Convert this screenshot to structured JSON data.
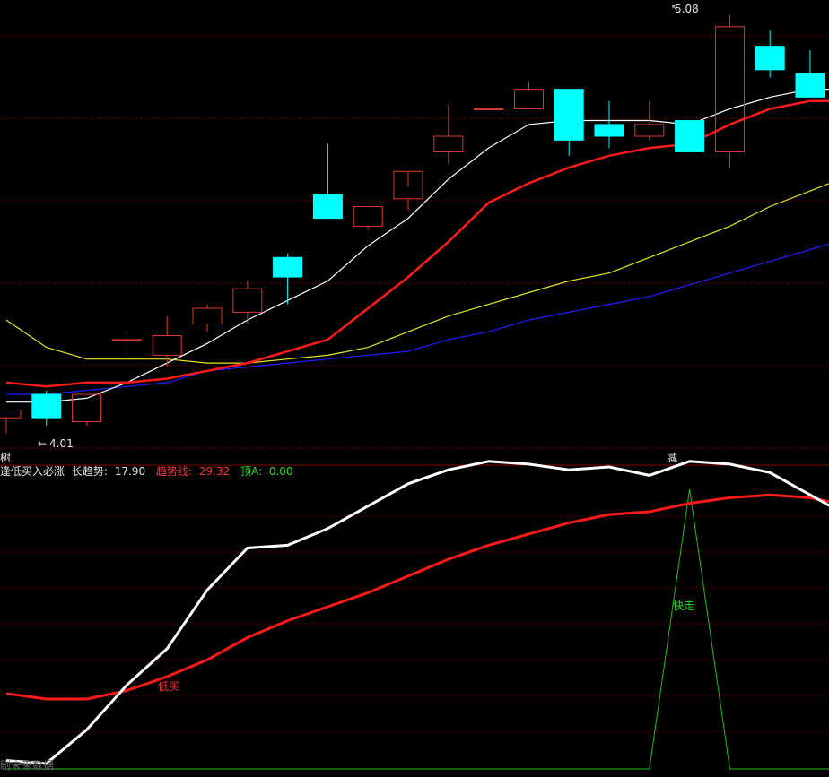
{
  "colors": {
    "background": "#000000",
    "grid": "#7a0000",
    "up_candle": "#e0392b",
    "down_candle": "#00ffff",
    "ma_short": "#ffffff",
    "ma_mid": "#ff1a1a",
    "ma_long1": "#e6e61e",
    "ma_long2": "#1e1eff",
    "osc_fast": "#ffffff",
    "osc_slow": "#ff1a1a",
    "signal": "#1ebe1e",
    "legend_white": "#e6e6e6",
    "legend_red": "#ff3030",
    "legend_green": "#22dd22"
  },
  "price_panel": {
    "high_marker": "5.08",
    "low_marker": "4.01",
    "left_label": "树",
    "right_label": "减"
  },
  "indicator_panel": {
    "title": "逢低买入必涨",
    "items": [
      {
        "label": "长趋势:",
        "value": "17.90"
      },
      {
        "label": "趋势线:",
        "value": "29.32"
      },
      {
        "label": "顶A:",
        "value": "0.00"
      }
    ],
    "buy_label": "低买",
    "sell_label": "快走",
    "footer_label": "剧未来数据"
  },
  "chart_data": [
    {
      "type": "candlestick",
      "ylim": [
        4.0,
        5.1
      ],
      "candles": [
        {
          "o": 4.05,
          "h": 4.07,
          "l": 4.01,
          "c": 4.07
        },
        {
          "o": 4.11,
          "h": 4.12,
          "l": 4.03,
          "c": 4.05
        },
        {
          "o": 4.04,
          "h": 4.11,
          "l": 4.03,
          "c": 4.11
        },
        {
          "o": 4.25,
          "h": 4.27,
          "l": 4.21,
          "c": 4.25
        },
        {
          "o": 4.21,
          "h": 4.31,
          "l": 4.18,
          "c": 4.26
        },
        {
          "o": 4.29,
          "h": 4.34,
          "l": 4.27,
          "c": 4.33
        },
        {
          "o": 4.32,
          "h": 4.4,
          "l": 4.29,
          "c": 4.38
        },
        {
          "o": 4.46,
          "h": 4.47,
          "l": 4.34,
          "c": 4.41
        },
        {
          "o": 4.62,
          "h": 4.75,
          "l": 4.56,
          "c": 4.56
        },
        {
          "o": 4.54,
          "h": 4.59,
          "l": 4.53,
          "c": 4.59
        },
        {
          "o": 4.61,
          "h": 4.64,
          "l": 4.58,
          "c": 4.68
        },
        {
          "o": 4.73,
          "h": 4.85,
          "l": 4.7,
          "c": 4.77
        },
        {
          "o": 4.84,
          "h": 4.84,
          "l": 4.84,
          "c": 4.84
        },
        {
          "o": 4.84,
          "h": 4.91,
          "l": 4.84,
          "c": 4.89
        },
        {
          "o": 4.89,
          "h": 4.89,
          "l": 4.72,
          "c": 4.76
        },
        {
          "o": 4.8,
          "h": 4.86,
          "l": 4.74,
          "c": 4.77
        },
        {
          "o": 4.77,
          "h": 4.86,
          "l": 4.76,
          "c": 4.8
        },
        {
          "o": 4.81,
          "h": 4.81,
          "l": 4.73,
          "c": 4.73
        },
        {
          "o": 4.73,
          "h": 5.08,
          "l": 4.69,
          "c": 5.05
        },
        {
          "o": 5.0,
          "h": 5.04,
          "l": 4.92,
          "c": 4.94
        },
        {
          "o": 4.93,
          "h": 4.99,
          "l": 4.87,
          "c": 4.87
        },
        {
          "o": 4.88,
          "h": 4.93,
          "l": 4.82,
          "c": 4.82
        },
        {
          "o": 4.82,
          "h": 4.84,
          "l": 4.76,
          "c": 4.76
        }
      ],
      "ma_short": [
        4.09,
        4.09,
        4.1,
        4.14,
        4.19,
        4.24,
        4.3,
        4.35,
        4.4,
        4.49,
        4.56,
        4.66,
        4.74,
        4.8,
        4.81,
        4.81,
        4.81,
        4.8,
        4.84,
        4.87,
        4.89,
        4.89,
        4.88
      ],
      "ma_mid": [
        4.14,
        4.13,
        4.14,
        4.14,
        4.15,
        4.17,
        4.19,
        4.22,
        4.25,
        4.33,
        4.41,
        4.5,
        4.6,
        4.65,
        4.69,
        4.72,
        4.74,
        4.75,
        4.8,
        4.84,
        4.86,
        4.86,
        4.85
      ],
      "ma_long1": [
        4.3,
        4.23,
        4.2,
        4.2,
        4.2,
        4.19,
        4.19,
        4.2,
        4.21,
        4.23,
        4.27,
        4.31,
        4.34,
        4.37,
        4.4,
        4.42,
        4.46,
        4.5,
        4.54,
        4.59,
        4.63,
        4.67,
        4.7
      ],
      "ma_long2": [
        4.11,
        4.11,
        4.12,
        4.13,
        4.14,
        4.17,
        4.18,
        4.19,
        4.2,
        4.21,
        4.22,
        4.25,
        4.27,
        4.3,
        4.32,
        4.34,
        4.36,
        4.39,
        4.42,
        4.45,
        4.48,
        4.51,
        4.53
      ]
    },
    {
      "type": "line",
      "ylim": [
        0,
        100
      ],
      "series": [
        {
          "values": [
            3,
            2,
            14,
            30,
            43,
            64,
            79,
            80,
            86,
            94,
            102,
            107,
            110,
            109,
            107,
            108,
            105,
            110,
            109,
            106,
            98,
            90,
            80
          ]
        },
        {
          "values": [
            27,
            25,
            25,
            28,
            33,
            39,
            47,
            53,
            58,
            63,
            69,
            75,
            80,
            84,
            88,
            91,
            92,
            95,
            97,
            98,
            97,
            94,
            89
          ]
        },
        {
          "values": [
            0,
            0,
            0,
            0,
            0,
            0,
            0,
            0,
            0,
            0,
            0,
            0,
            0,
            0,
            0,
            0,
            0,
            100,
            0,
            0,
            0,
            0,
            0
          ]
        }
      ]
    }
  ]
}
